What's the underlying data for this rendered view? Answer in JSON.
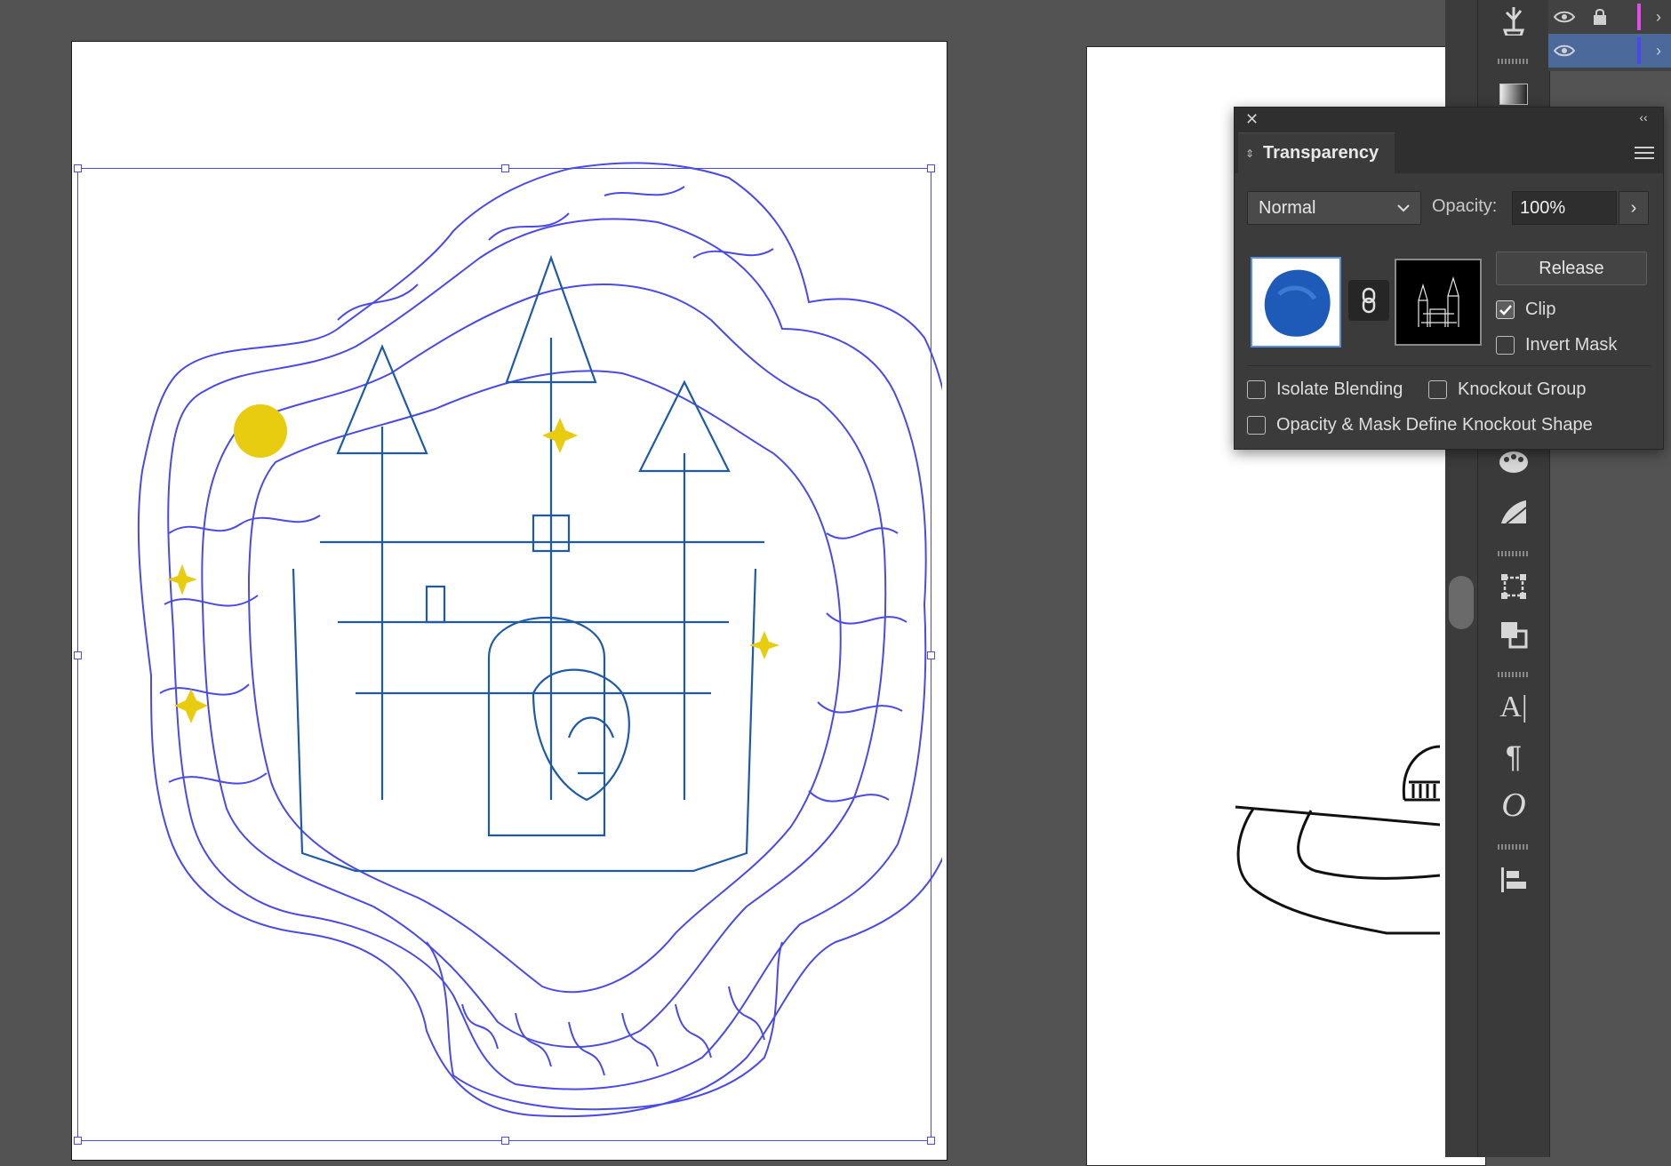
{
  "transparency_panel": {
    "title": "Transparency",
    "blend_mode": "Normal",
    "opacity_label": "Opacity:",
    "opacity_value": "100%",
    "release_label": "Release",
    "clip_label": "Clip",
    "clip_checked": true,
    "invert_mask_label": "Invert Mask",
    "invert_mask_checked": false,
    "isolate_blending_label": "Isolate Blending",
    "isolate_blending_checked": false,
    "knockout_group_label": "Knockout Group",
    "knockout_group_checked": false,
    "opacity_mask_knockout_label": "Opacity & Mask Define Knockout Shape",
    "opacity_mask_knockout_checked": false
  },
  "layers_panel": {
    "rows": [
      {
        "visible": true,
        "locked": true,
        "color": "#e04ee6",
        "selected": false
      },
      {
        "visible": true,
        "locked": false,
        "color": "#4a4ae6",
        "selected": true
      }
    ]
  },
  "tool_dock": {
    "icons": [
      "puppet-warp-icon",
      "gradient-icon",
      "color-guide-icon",
      "brushes-palette-icon",
      "transform-icon",
      "pathfinder-icon",
      "character-icon",
      "paragraph-icon",
      "opentype-icon",
      "align-icon"
    ]
  },
  "colors": {
    "selection": "#4a4ae6",
    "accent_yellow": "#e8cc10",
    "canvas": "#535353",
    "panel": "#3b3b3b"
  }
}
